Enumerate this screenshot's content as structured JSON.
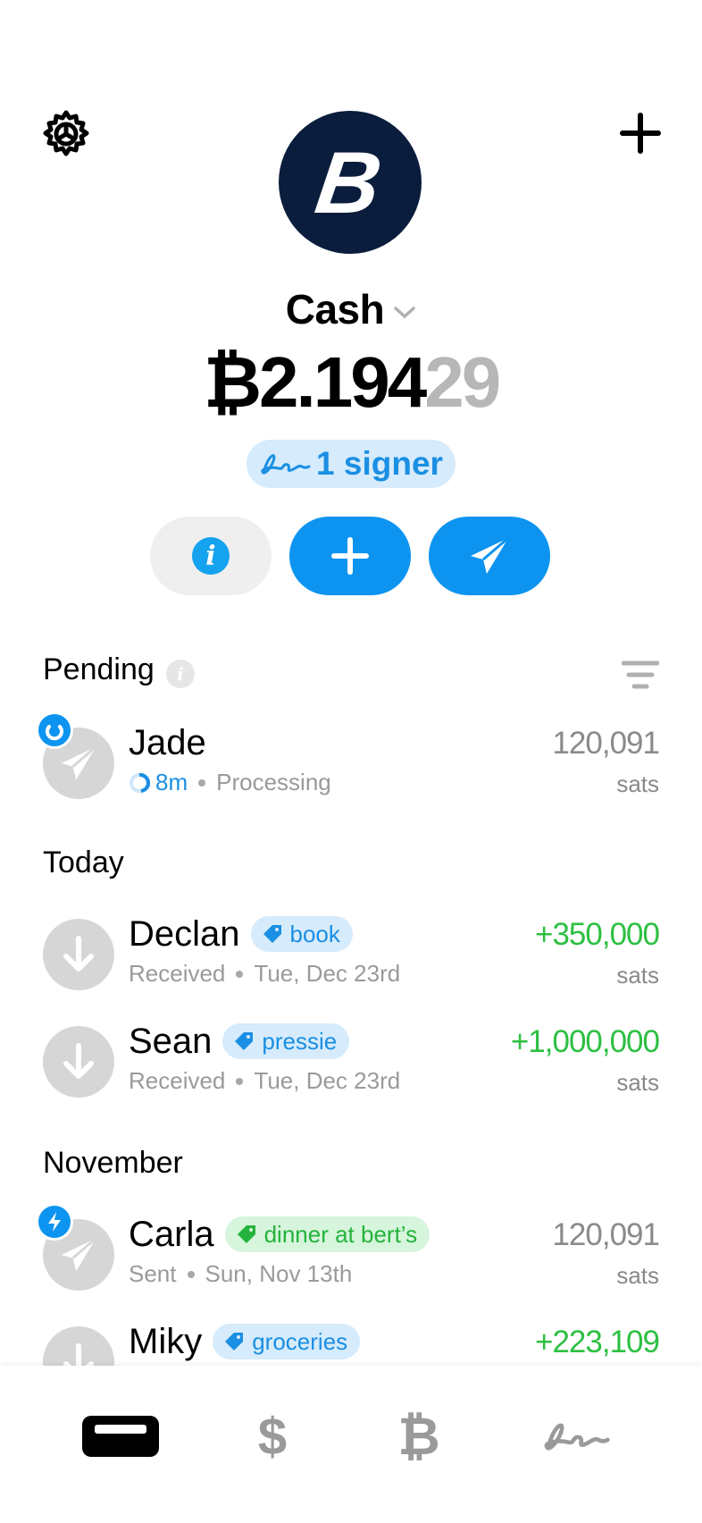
{
  "header": {
    "settings_icon": "gear-icon",
    "add_icon": "plus-icon",
    "avatar_symbol": "B",
    "account_name": "Cash",
    "balance_main": "₿2.194",
    "balance_dim": "29",
    "signer_label": "1 signer"
  },
  "actions": [
    {
      "name": "info",
      "icon": "info-icon"
    },
    {
      "name": "add",
      "icon": "plus-icon"
    },
    {
      "name": "send",
      "icon": "paper-plane-icon"
    }
  ],
  "pending": {
    "title": "Pending",
    "items": [
      {
        "name": "Jade",
        "time": "8m",
        "status": "Processing",
        "amount": "120,091",
        "unit": "sats"
      }
    ]
  },
  "today": {
    "title": "Today",
    "items": [
      {
        "name": "Declan",
        "tag": "book",
        "status": "Received",
        "date": "Tue, Dec 23rd",
        "amount": "+350,000",
        "unit": "sats"
      },
      {
        "name": "Sean",
        "tag": "pressie",
        "status": "Received",
        "date": "Tue, Dec 23rd",
        "amount": "+1,000,000",
        "unit": "sats"
      }
    ]
  },
  "november": {
    "title": "November",
    "items": [
      {
        "name": "Carla",
        "tag": "dinner at bert’s",
        "status": "Sent",
        "date": "Sun, Nov 13th",
        "amount": "120,091",
        "unit": "sats"
      },
      {
        "name": "Miky",
        "tag": "groceries",
        "amount": "+223,109"
      }
    ]
  },
  "tabbar": {
    "items": [
      {
        "name": "home",
        "icon": "wallet-icon"
      },
      {
        "name": "cash",
        "label": "$"
      },
      {
        "name": "bitcoin",
        "label": "₿"
      },
      {
        "name": "signers",
        "icon": "signature-icon"
      }
    ]
  },
  "colors": {
    "accent": "#0d94f0",
    "positive": "#2dc043",
    "avatar_bg": "#0b1d3d",
    "tag_blue_bg": "#d6ebfb",
    "tag_green_bg": "#d6f5dc"
  }
}
